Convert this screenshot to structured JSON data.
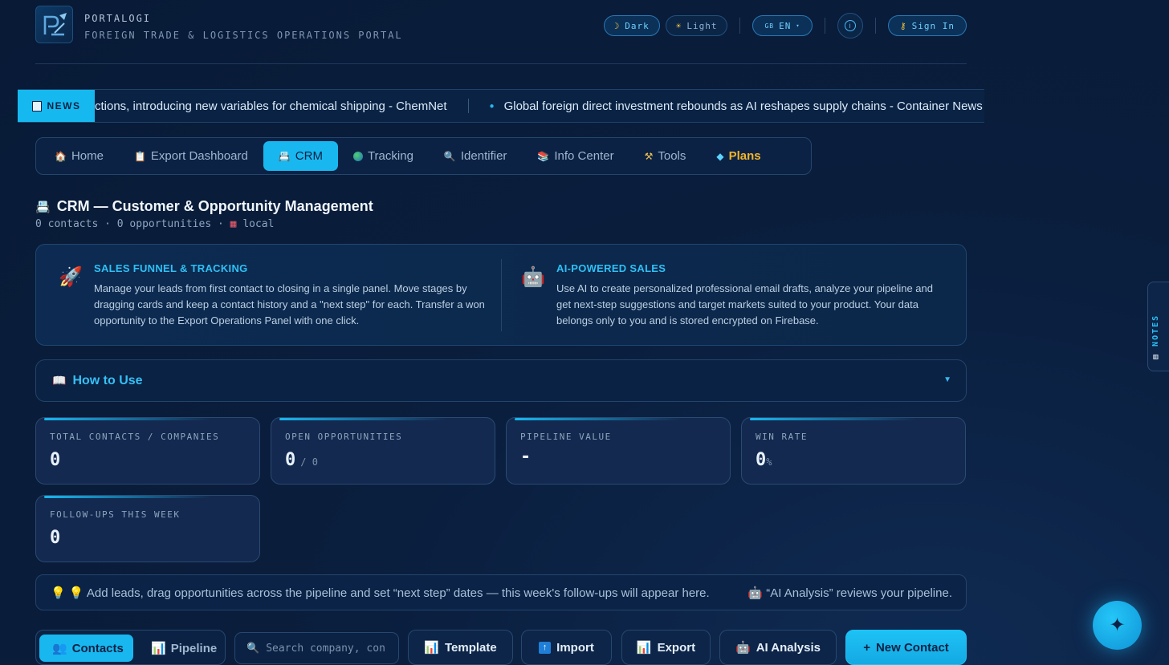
{
  "brand": {
    "name": "PORTALOGI",
    "subtitle": "FOREIGN TRADE & LOGISTICS OPERATIONS PORTAL"
  },
  "header": {
    "theme_dark": "Dark",
    "theme_light": "Light",
    "lang": "EN",
    "sign_in": "Sign In"
  },
  "news": {
    "tag": "NEWS",
    "item_1": "ctions, introducing new variables for chemical shipping - ChemNet",
    "item_2": "Global foreign direct investment rebounds as AI reshapes supply chains - Container News"
  },
  "nav": [
    {
      "label": "Home",
      "icon": "home-icon"
    },
    {
      "label": "Export Dashboard",
      "icon": "clipboard-icon"
    },
    {
      "label": "CRM",
      "icon": "rolodex-icon"
    },
    {
      "label": "Tracking",
      "icon": "globe-icon"
    },
    {
      "label": "Identifier",
      "icon": "magnifier-icon"
    },
    {
      "label": "Info Center",
      "icon": "books-icon"
    },
    {
      "label": "Tools",
      "icon": "tools-icon"
    },
    {
      "label": "Plans",
      "icon": "gem-icon"
    }
  ],
  "page": {
    "title": "CRM — Customer & Opportunity Management",
    "contacts": "0 contacts",
    "opportunities": "0 opportunities",
    "storage": "local"
  },
  "features": {
    "left_title": "SALES FUNNEL & TRACKING",
    "left_body": "Manage your leads from first contact to closing in a single panel. Move stages by dragging cards and keep a contact history and a \"next step\" for each. Transfer a won opportunity to the Export Operations Panel with one click.",
    "right_title": "AI-POWERED SALES",
    "right_body": "Use AI to create personalized professional email drafts, analyze your pipeline and get next-step suggestions and target markets suited to your product. Your data belongs only to you and is stored encrypted on Firebase."
  },
  "howto": {
    "label": "How to Use"
  },
  "stats": {
    "total_label": "TOTAL CONTACTS / COMPANIES",
    "total_value": "0",
    "open_label": "OPEN OPPORTUNITIES",
    "open_value": "0",
    "open_sub": "/ 0",
    "pipeline_label": "PIPELINE VALUE",
    "pipeline_value": "-",
    "win_label": "WIN RATE",
    "win_value": "0",
    "win_unit": "%",
    "followup_label": "FOLLOW-UPS THIS WEEK",
    "followup_value": "0"
  },
  "tip": {
    "left": "Add leads, drag opportunities across the pipeline and set “next step” dates — this week's follow-ups will appear here.",
    "right": "“AI Analysis” reviews your pipeline."
  },
  "toolbar": {
    "contacts": "Contacts",
    "pipeline": "Pipeline",
    "search_placeholder": "Search company, con",
    "template": "Template",
    "import": "Import",
    "export": "Export",
    "ai_analysis": "AI Analysis",
    "new_contact": "New Contact"
  },
  "side": {
    "notes": "NOTES"
  }
}
